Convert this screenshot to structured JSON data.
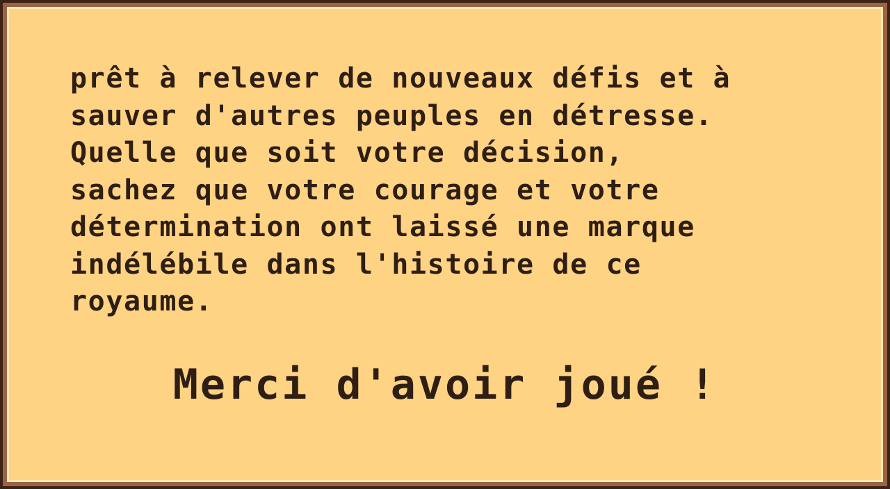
{
  "dialog": {
    "lines": [
      "prêt à relever de nouveaux défis et à",
      "sauver d'autres peuples en détresse.",
      "Quelle que soit votre décision,",
      "sachez que votre courage et votre",
      "détermination ont laissé une marque",
      "indélébile dans l'histoire de ce",
      "royaume."
    ],
    "closing": "Merci d'avoir joué !"
  },
  "colors": {
    "panel_background": "#fed384",
    "frame_dark": "#3b2317",
    "frame_brown": "#9c6246",
    "frame_highlight": "#ffe9b0",
    "text": "#2e1e14"
  }
}
